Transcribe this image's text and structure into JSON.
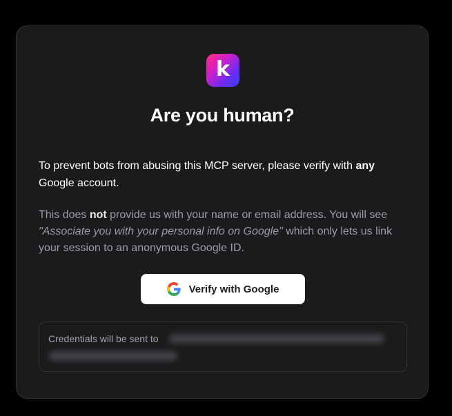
{
  "logo": {
    "letter": "k",
    "icon": "kinde-k-logo"
  },
  "title": "Are you human?",
  "intro": {
    "part1": "To prevent bots from abusing this MCP server, please verify with ",
    "bold": "any",
    "part2": " Google account."
  },
  "note": {
    "part1": "This does ",
    "bold": "not",
    "part2": " provide us with your name or email address. You will see ",
    "italic": "\"Associate you with your personal info on Google\"",
    "part3": " which only lets us link your session to an anonymous Google ID."
  },
  "verify_button": {
    "label": "Verify with Google",
    "icon": "google-g-icon"
  },
  "credentials": {
    "label": "Credentials will be sent to"
  },
  "colors": {
    "background": "#000000",
    "card": "#1b1b1d",
    "border": "#333336",
    "muted_text": "#9c9ca3",
    "button_bg": "#ffffff"
  }
}
